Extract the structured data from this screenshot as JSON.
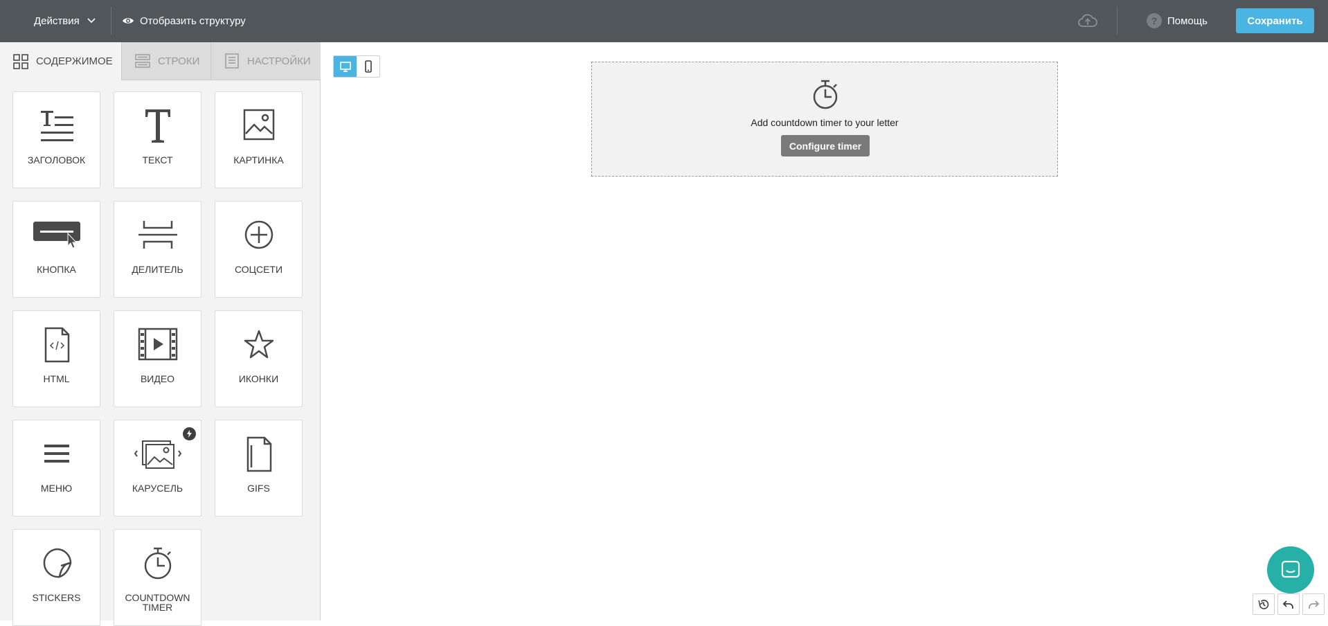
{
  "topbar": {
    "actions_label": "Действия",
    "show_structure_label": "Отобразить структуру",
    "help_label": "Помощь",
    "save_label": "Сохранить"
  },
  "tabs": [
    {
      "label": "СОДЕРЖИМОЕ",
      "active": true
    },
    {
      "label": "СТРОКИ",
      "active": false
    },
    {
      "label": "НАСТРОЙКИ",
      "active": false
    }
  ],
  "blocks": [
    {
      "label": "ЗАГОЛОВОК",
      "icon": "heading-icon"
    },
    {
      "label": "ТЕКСТ",
      "icon": "text-icon"
    },
    {
      "label": "КАРТИНКА",
      "icon": "image-icon"
    },
    {
      "label": "КНОПКА",
      "icon": "button-icon"
    },
    {
      "label": "ДЕЛИТЕЛЬ",
      "icon": "divider-icon"
    },
    {
      "label": "СОЦСЕТИ",
      "icon": "social-icon"
    },
    {
      "label": "HTML",
      "icon": "html-icon"
    },
    {
      "label": "ВИДЕО",
      "icon": "video-icon"
    },
    {
      "label": "ИКОНКИ",
      "icon": "star-icon"
    },
    {
      "label": "МЕНЮ",
      "icon": "menu-icon"
    },
    {
      "label": "КАРУСЕЛЬ",
      "icon": "carousel-icon"
    },
    {
      "label": "GIFS",
      "icon": "gifs-icon"
    },
    {
      "label": "STICKERS",
      "icon": "sticker-icon"
    },
    {
      "label": "COUNTDOWN\nTIMER",
      "icon": "timer-icon"
    }
  ],
  "canvas": {
    "timer_text": "Add countdown timer to your letter",
    "timer_button": "Configure timer"
  },
  "colors": {
    "topbar": "#505659",
    "accent": "#4ab5e3",
    "chat": "#26b0a8"
  }
}
